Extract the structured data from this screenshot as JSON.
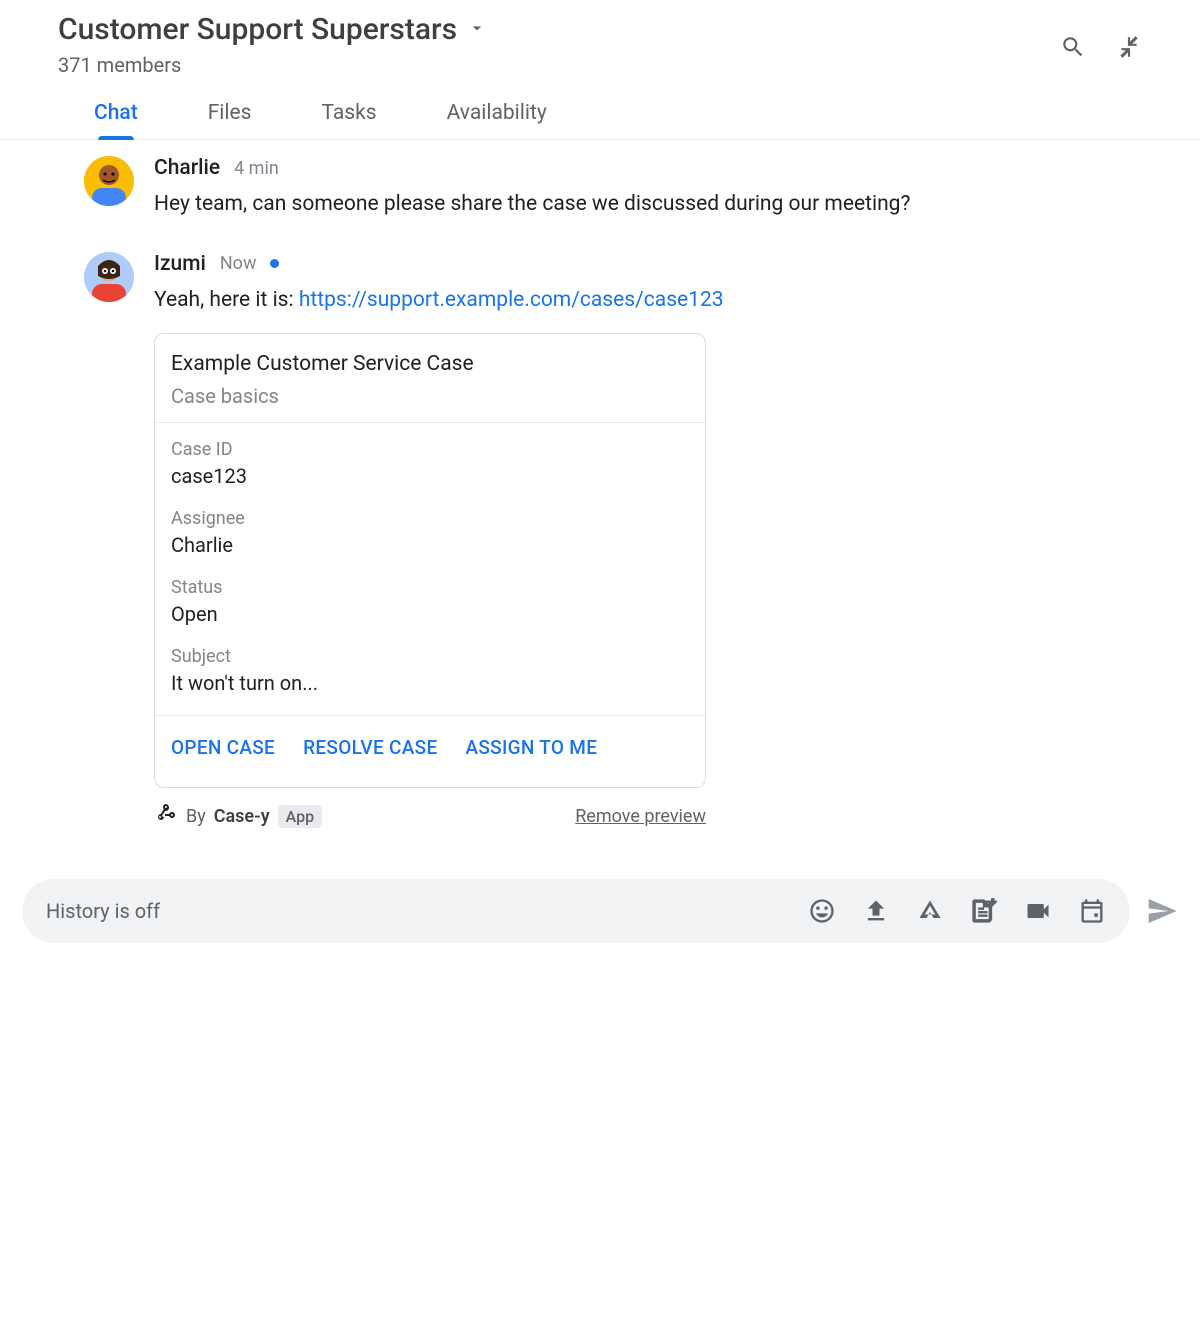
{
  "header": {
    "room_title": "Customer Support Superstars",
    "members": "371 members"
  },
  "tabs": [
    {
      "label": "Chat",
      "active": true
    },
    {
      "label": "Files",
      "active": false
    },
    {
      "label": "Tasks",
      "active": false
    },
    {
      "label": "Availability",
      "active": false
    }
  ],
  "messages": [
    {
      "author": "Charlie",
      "timestamp": "4 min",
      "text": "Hey team, can someone please share the case we discussed during our meeting?"
    },
    {
      "author": "Izumi",
      "timestamp": "Now",
      "now_indicator": true,
      "text_prefix": "Yeah, here it is: ",
      "link": "https://support.example.com/cases/case123",
      "card": {
        "title": "Example Customer Service Case",
        "subtitle": "Case basics",
        "fields": [
          {
            "label": "Case ID",
            "value": "case123"
          },
          {
            "label": "Assignee",
            "value": "Charlie"
          },
          {
            "label": "Status",
            "value": "Open"
          },
          {
            "label": "Subject",
            "value": "It won't turn on..."
          }
        ],
        "actions": [
          "OPEN CASE",
          "RESOLVE CASE",
          "ASSIGN TO ME"
        ],
        "by_prefix": "By ",
        "by_name": "Case-y",
        "app_badge": "App",
        "remove_preview": "Remove preview"
      }
    }
  ],
  "composer": {
    "placeholder": "History is off"
  }
}
